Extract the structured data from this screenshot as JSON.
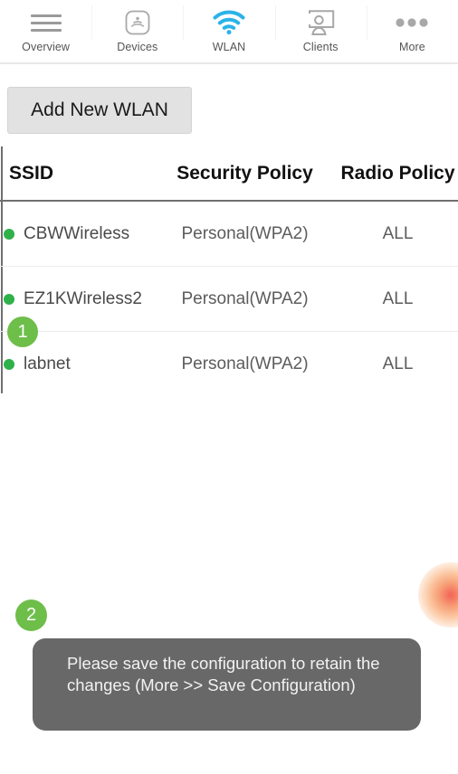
{
  "nav": {
    "items": [
      {
        "label": "Overview",
        "icon": "hamburger-menu-icon",
        "active": false
      },
      {
        "label": "Devices",
        "icon": "access-point-icon",
        "active": false
      },
      {
        "label": "WLAN",
        "icon": "wifi-icon",
        "active": true
      },
      {
        "label": "Clients",
        "icon": "client-monitor-icon",
        "active": false
      },
      {
        "label": "More",
        "icon": "ellipsis-icon",
        "active": false
      }
    ]
  },
  "toolbar": {
    "add_wlan_label": "Add New WLAN"
  },
  "table": {
    "columns": [
      "SSID",
      "Security Policy",
      "Radio Policy"
    ],
    "rows": [
      {
        "status": "enabled",
        "ssid": "CBWWireless",
        "security": "Personal(WPA2)",
        "radio": "ALL"
      },
      {
        "status": "enabled",
        "ssid": "EZ1KWireless2",
        "security": "Personal(WPA2)",
        "radio": "ALL"
      },
      {
        "status": "enabled",
        "ssid": "labnet",
        "security": "Personal(WPA2)",
        "radio": "ALL"
      }
    ]
  },
  "annotations": {
    "step_one": "1",
    "step_two": "2"
  },
  "toast": {
    "message": "Please save the configuration to retain the changes (More >> Save Configuration)"
  },
  "colors": {
    "accent_wifi": "#2ab3e8",
    "status_dot": "#2fb14a",
    "step_badge": "#6ebe4a",
    "toast_bg": "#686868",
    "button_bg": "#e2e2e2",
    "touch_glow": "#f1655a"
  }
}
